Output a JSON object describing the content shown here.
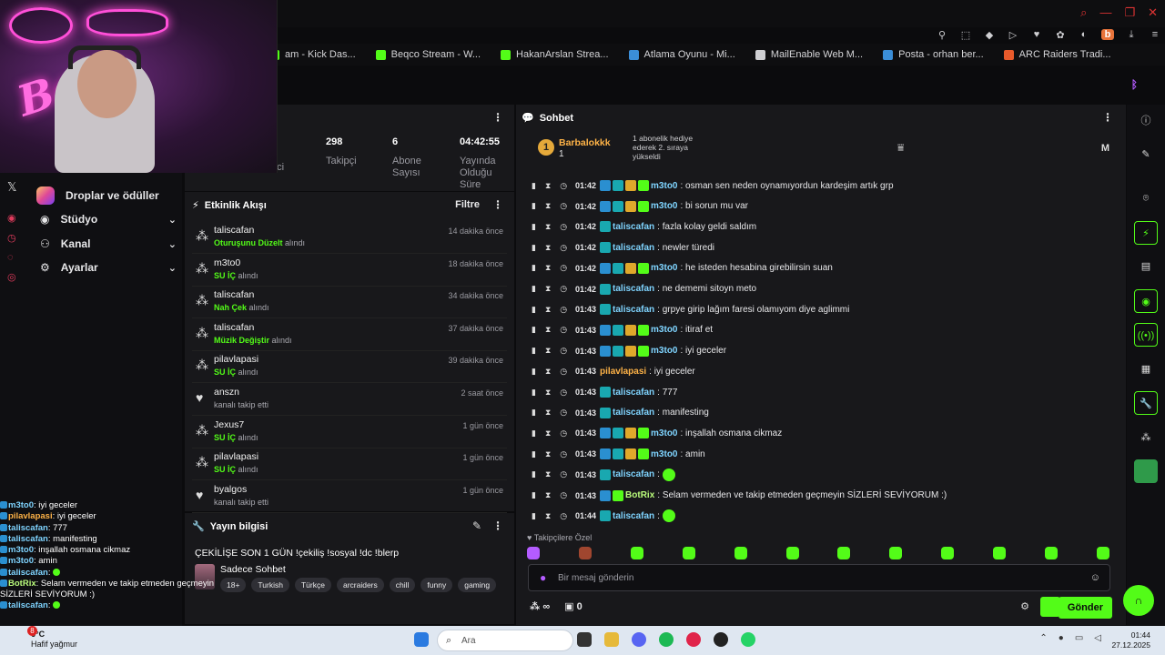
{
  "bookmarks": [
    {
      "label": "am - Kick Das...",
      "color": "#53fc18"
    },
    {
      "label": "Beqco Stream - W...",
      "color": "#53fc18"
    },
    {
      "label": "HakanArslan Strea...",
      "color": "#53fc18"
    },
    {
      "label": "Atlama Oyunu - Mi...",
      "color": "#3b8ed8"
    },
    {
      "label": "MailEnable Web M...",
      "color": "#cfcfd2"
    },
    {
      "label": "Posta - orhan ber...",
      "color": "#3b8ed8"
    },
    {
      "label": "ARC Raiders Tradi...",
      "color": "#e85a2b"
    }
  ],
  "webcam": {
    "neon_text": "Beco"
  },
  "leftnav": {
    "items": [
      {
        "label": "Droplar ve ödüller",
        "icon": "instagram-icon"
      },
      {
        "label": "Stüdyo",
        "icon": "camera-icon"
      },
      {
        "label": "Kanal",
        "icon": "users-icon"
      },
      {
        "label": "Ayarlar",
        "icon": "gear-icon"
      }
    ]
  },
  "overlay_chat": [
    {
      "user": "m3to0",
      "text": "iyi geceler",
      "color": "blue"
    },
    {
      "user": "pilavlapasi",
      "text": "iyi geceler",
      "color": "orange"
    },
    {
      "user": "taliscafan",
      "text": "777",
      "color": "blue"
    },
    {
      "user": "taliscafan",
      "text": "manifesting",
      "color": "blue"
    },
    {
      "user": "m3to0",
      "text": "inşallah osmana cikmaz",
      "color": "blue"
    },
    {
      "user": "m3to0",
      "text": "amin",
      "color": "blue"
    },
    {
      "user": "taliscafan",
      "text": "",
      "color": "blue"
    },
    {
      "user": "BotRix",
      "text": "Selam vermeden ve takip etmeden geçmeyin SİZLERİ SEVİYORUM :)",
      "color": "green"
    },
    {
      "user": "taliscafan",
      "text": "",
      "color": "blue"
    }
  ],
  "stats": [
    {
      "value": "",
      "label": "rici"
    },
    {
      "value": "298",
      "label": "Takipçi"
    },
    {
      "value": "6",
      "label": "Abone Sayısı"
    },
    {
      "value": "04:42:55",
      "label": "Yayında Olduğu Süre"
    }
  ],
  "feed": {
    "title": "Etkinlik Akışı",
    "filter_label": "Filtre",
    "items": [
      {
        "user": "taliscafan",
        "reward": "Oturuşunu Düzelt",
        "suffix": "alındı",
        "time": "14 dakika önce",
        "icon": "points"
      },
      {
        "user": "m3to0",
        "reward": "SU İÇ",
        "suffix": "alındı",
        "time": "18 dakika önce",
        "icon": "points"
      },
      {
        "user": "taliscafan",
        "reward": "Nah Çek",
        "suffix": "alındı",
        "time": "34 dakika önce",
        "icon": "points"
      },
      {
        "user": "taliscafan",
        "reward": "Müzik Değiştir",
        "suffix": "alındı",
        "time": "37 dakika önce",
        "icon": "points"
      },
      {
        "user": "pilavlapasi",
        "reward": "SU İÇ",
        "suffix": "alındı",
        "time": "39 dakika önce",
        "icon": "points"
      },
      {
        "user": "anszn",
        "reward": "",
        "suffix": "kanalı takip etti",
        "time": "2 saat önce",
        "icon": "heart"
      },
      {
        "user": "Jexus7",
        "reward": "SU İÇ",
        "suffix": "alındı",
        "time": "1 gün önce",
        "icon": "points"
      },
      {
        "user": "pilavlapasi",
        "reward": "SU İÇ",
        "suffix": "alındı",
        "time": "1 gün önce",
        "icon": "points"
      },
      {
        "user": "byalgos",
        "reward": "",
        "suffix": "kanalı takip etti",
        "time": "1 gün önce",
        "icon": "heart"
      }
    ]
  },
  "stream_info": {
    "title": "Yayın bilgisi",
    "stream_title": "ÇEKİLİŞE SON 1 GÜN !çekiliş !sosyal !dc !blerp",
    "category": "Sadece Sohbet",
    "tags": [
      "18+",
      "Turkish",
      "Türkçe",
      "arcraiders",
      "chill",
      "funny",
      "gaming"
    ]
  },
  "chat": {
    "title": "Sohbet",
    "pinned": {
      "rank": "1",
      "name": "Barbalokkk",
      "sub": "1",
      "message": "1 abonelik hediye ederek 2. sıraya yükseldi",
      "m": "M"
    },
    "messages": [
      {
        "time": "01:42",
        "user": "m3to0",
        "text": "osman sen neden oynamıyordun kardeşim artık grp",
        "style": "full"
      },
      {
        "time": "01:42",
        "user": "m3to0",
        "text": "bi sorun mu var",
        "style": "full"
      },
      {
        "time": "01:42",
        "user": "taliscafan",
        "text": "fazla kolay geldi saldım",
        "style": "single"
      },
      {
        "time": "01:42",
        "user": "taliscafan",
        "text": "newler türedi",
        "style": "single"
      },
      {
        "time": "01:42",
        "user": "m3to0",
        "text": "he isteden hesabina girebilirsin suan",
        "style": "full"
      },
      {
        "time": "01:42",
        "user": "taliscafan",
        "text": "ne dememi sitoyn meto",
        "style": "single"
      },
      {
        "time": "01:43",
        "user": "taliscafan",
        "text": "grpye girip lağım faresi olamıyom diye aglimmi",
        "style": "single"
      },
      {
        "time": "01:43",
        "user": "m3to0",
        "text": "itiraf et",
        "style": "full"
      },
      {
        "time": "01:43",
        "user": "m3to0",
        "text": "iyi geceler",
        "style": "full"
      },
      {
        "time": "01:43",
        "user": "pilavlapasi",
        "text": "iyi geceler",
        "style": "plain"
      },
      {
        "time": "01:43",
        "user": "taliscafan",
        "text": "777",
        "style": "single"
      },
      {
        "time": "01:43",
        "user": "taliscafan",
        "text": "manifesting",
        "style": "single"
      },
      {
        "time": "01:43",
        "user": "m3to0",
        "text": "inşallah osmana cikmaz",
        "style": "full"
      },
      {
        "time": "01:43",
        "user": "m3to0",
        "text": "amin",
        "style": "full"
      },
      {
        "time": "01:43",
        "user": "taliscafan",
        "text": "",
        "style": "emote"
      },
      {
        "time": "01:43",
        "user": "BotRix",
        "text": "Selam vermeden ve takip etmeden geçmeyin SİZLERİ SEVİYORUM :)",
        "style": "bot"
      },
      {
        "time": "01:44",
        "user": "taliscafan",
        "text": "",
        "style": "emote"
      }
    ],
    "followers_label": "Takipçilere Özel",
    "input_placeholder": "Bir mesaj gönderin",
    "points_label": "∞",
    "drops_count": "0",
    "send_label": "Gönder"
  },
  "taskbar": {
    "weather_badge": "8",
    "temp": "6°C",
    "weather": "Hafif yağmur",
    "search": "Ara",
    "time": "01:44",
    "date": "27.12.2025"
  },
  "colors": {
    "accent": "#53fc18",
    "panel": "#18181b",
    "bg": "#0b0b0d"
  }
}
